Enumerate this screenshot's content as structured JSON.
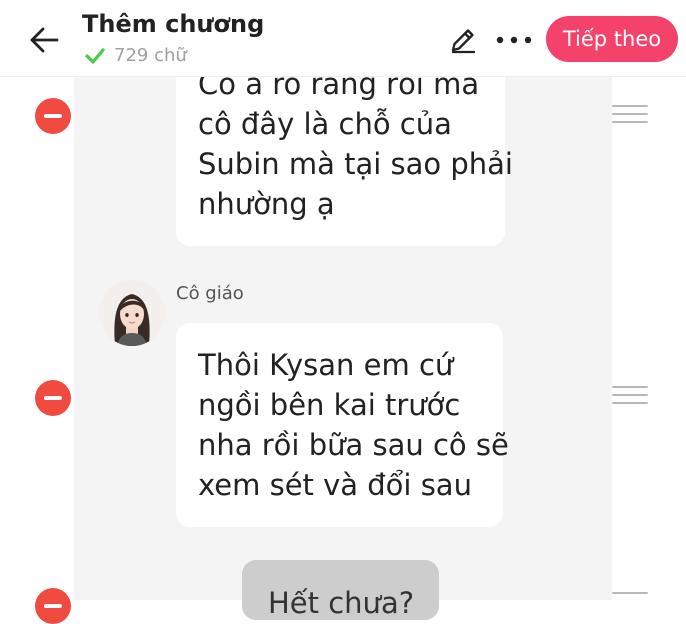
{
  "header": {
    "title": "Thêm chương",
    "word_count": "729 chữ",
    "next_label": "Tiếp theo"
  },
  "messages": [
    {
      "lines": [
        "Cô à rõ ràng rồi mà",
        "cô đây là chỗ của",
        "Subin mà tại sao phải",
        "nhường ạ"
      ]
    },
    {
      "sender": "Cô giáo",
      "lines": [
        "Thôi Kysan em cứ",
        "ngồi bên kai trước",
        "nha rồi bữa sau cô sẽ",
        "xem sét và đổi sau"
      ]
    },
    {
      "lines": [
        "Hết chưa?"
      ]
    }
  ],
  "colors": {
    "accent": "#f5426a",
    "remove": "#f04a41",
    "check": "#4cc94a",
    "chat_background": "#f4f4f4"
  },
  "icons": [
    "back-arrow-icon",
    "check-icon",
    "pencil-icon",
    "more-dots-icon",
    "remove-icon",
    "drag-handle-icon"
  ]
}
